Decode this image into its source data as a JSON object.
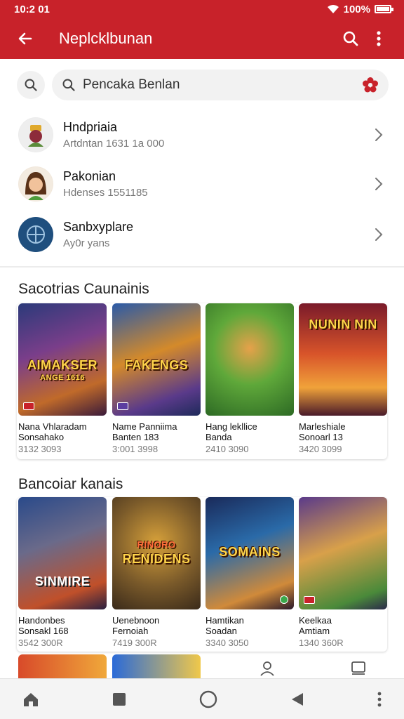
{
  "status": {
    "time": "10:2 01",
    "battery": "100%",
    "battery_level": 1.0
  },
  "app_bar": {
    "title": "Neplcklbunan"
  },
  "search": {
    "value": "Pencaka Benlan"
  },
  "contacts": [
    {
      "name": "Hndpriaia",
      "sub": "Artdntan 1631 1a 000"
    },
    {
      "name": "Pakonian",
      "sub": "Hdenses 1551185"
    },
    {
      "name": "Sanbxyplare",
      "sub": "Ay0r yans"
    }
  ],
  "sections": [
    {
      "title": "Sacotrias Caunainis",
      "cards": [
        {
          "label": "AIMAKSER",
          "sublabel": "ANGE 1616",
          "title": "Nana Vhlaradam",
          "subtitle": "Sonsahako",
          "meta": "3132 3093"
        },
        {
          "label": "FAKENGS",
          "sublabel": "",
          "title": "Name Panniima",
          "subtitle": "Banten 183",
          "meta": "3:001 3998"
        },
        {
          "label": "",
          "sublabel": "",
          "title": "Hang lekllice",
          "subtitle": "Banda",
          "meta": "2410 3090"
        },
        {
          "label": "NUNIN NIN",
          "sublabel": "",
          "title": "Marleshiale",
          "subtitle": "Sonoarl 13",
          "meta": "3420 3099"
        }
      ]
    },
    {
      "title": "Bancoiar kanais",
      "cards": [
        {
          "label": "SINMIRE",
          "sublabel": "",
          "title": "Handonbes",
          "subtitle": "Sonsakl 168",
          "meta": "3542 300R"
        },
        {
          "label": "RENIDENS",
          "sublabel": "RINORO",
          "title": "Uenebnoon",
          "subtitle": "Fernoiah",
          "meta": "7419 300R"
        },
        {
          "label": "SOMAINS",
          "sublabel": "",
          "title": "Hamtikan",
          "subtitle": "Soadan",
          "meta": "3340 3050"
        },
        {
          "label": "",
          "sublabel": "",
          "title": "Keelkaa",
          "subtitle": "Amtiam",
          "meta": "1340 360R"
        }
      ]
    }
  ],
  "colors": {
    "accent": "#c8222a",
    "background": "#ffffff"
  },
  "icons": [
    "back-arrow-icon",
    "search-icon",
    "more-vert-icon",
    "flower-icon",
    "chevron-right-icon",
    "person-icon",
    "library-icon",
    "home-icon",
    "square-icon",
    "circle-icon",
    "triangle-back-icon"
  ]
}
